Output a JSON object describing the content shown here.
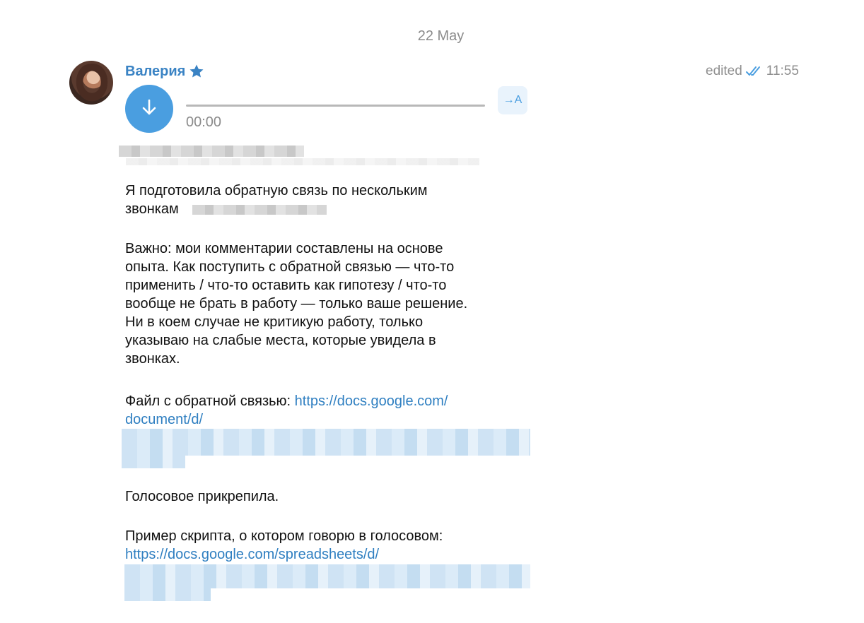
{
  "date_separator": "22 May",
  "message": {
    "sender": "Валерия",
    "edited_label": "edited",
    "time": "11:55",
    "voice": {
      "duration": "00:00",
      "translate_label": "→A"
    },
    "paragraph1_line1": "Я подготовила обратную связь по нескольким",
    "paragraph1_line2": "звонкам",
    "paragraph2": "Важно: мои комментарии составлены на основе\nопыта. Как поступить с обратной связью — что-то\nприменить / что-то оставить как гипотезу / что-то\nвообще не брать в работу — только ваше решение.\nНи в коем случае не критикую работу, только\nуказываю на слабые места, которые увидела в\nзвонках.",
    "file_prefix": "Файл с обратной связью: ",
    "file_link_1": "https://docs.google.com/",
    "file_link_2": "document/d/",
    "voice_attached": "Голосовое прикрепила.",
    "script_intro": "Пример скрипта, о котором говорю в голосовом:",
    "script_link": "https://docs.google.com/spreadsheets/d/"
  },
  "colors": {
    "sender": "#3a83c4",
    "link": "#2f7fc1",
    "accent": "#4a9ee0",
    "muted": "#8b8b8b"
  },
  "icons": {
    "star": "star-icon",
    "ticks": "double-check-icon",
    "download": "arrow-down-icon"
  }
}
